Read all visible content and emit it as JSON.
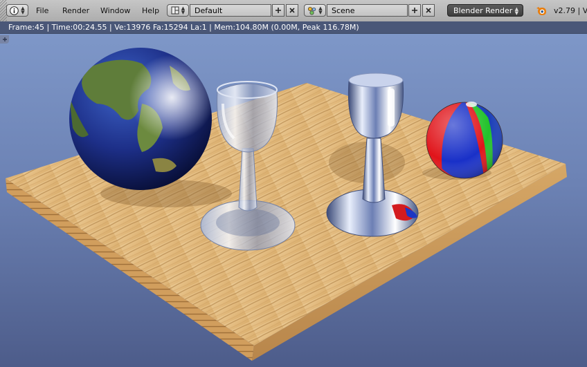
{
  "header": {
    "menus": [
      {
        "label": "File"
      },
      {
        "label": "Render"
      },
      {
        "label": "Window"
      },
      {
        "label": "Help"
      }
    ],
    "screen_layout": "Default",
    "scene": "Scene",
    "render_engine": "Blender Render",
    "version": "v2.79 | V",
    "icons": {
      "info": "info-icon",
      "layout": "screen-layout-icon",
      "scene": "scene-icon",
      "blender_logo": "blender-logo-icon"
    }
  },
  "info_strip": {
    "text": "Frame:45 | Time:00:24.55 | Ve:13976 Fa:15294 La:1 | Mem:104.80M (0.00M, Peak 116.78M)"
  },
  "colors": {
    "header_bg": "#b7b7b7",
    "viewport_top": "#7e97c8",
    "viewport_bottom": "#4d5c8a",
    "wood": "#e6c28a",
    "ball_red": "#e0141a",
    "ball_blue": "#1930c8",
    "ball_green": "#22c22a"
  }
}
